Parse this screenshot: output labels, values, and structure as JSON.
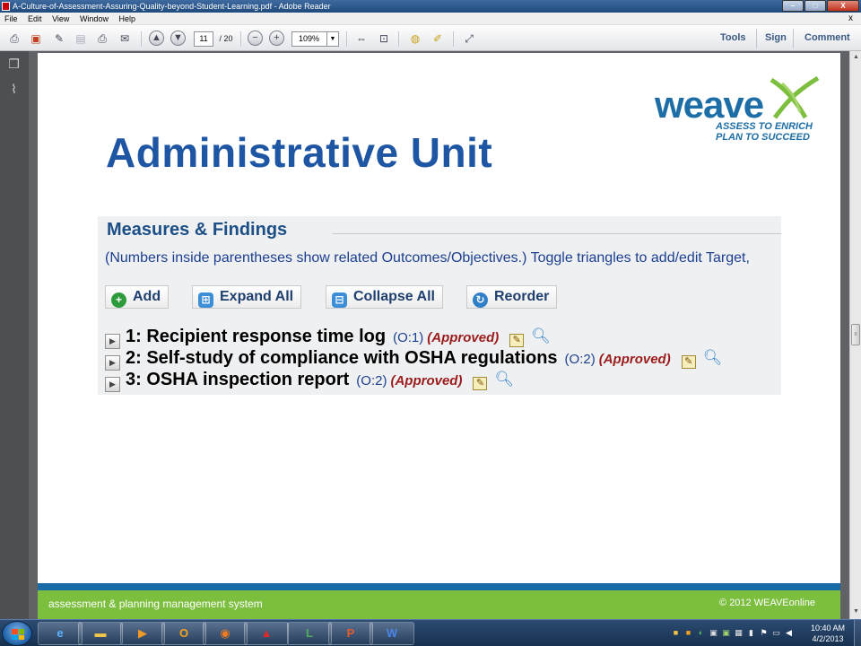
{
  "window": {
    "title": "A-Culture-of-Assessment-Assuring-Quality-beyond-Student-Learning.pdf - Adobe Reader",
    "minimize": "–",
    "maximize": "□",
    "close": "X"
  },
  "menu": {
    "items": [
      "File",
      "Edit",
      "View",
      "Window",
      "Help"
    ],
    "close_glyph": "x"
  },
  "toolbar": {
    "current_page": "11",
    "total_pages": "/ 20",
    "zoom": "109%",
    "links": [
      "Tools",
      "Sign",
      "Comment"
    ]
  },
  "slide": {
    "title": "Administrative Unit",
    "logo": {
      "word": "weave",
      "tagline_1": "ASSESS TO ENRICH",
      "tagline_2": "PLAN TO SUCCEED"
    },
    "panel": {
      "heading": "Measures & Findings",
      "note": "(Numbers inside parentheses show related Outcomes/Objectives.) Toggle triangles to add/edit Target,",
      "buttons": [
        "Add",
        "Expand All",
        "Collapse All",
        "Reorder"
      ],
      "measures": [
        {
          "title": "1: Recipient response time log",
          "ref": "(O:1)",
          "status": "(Approved)"
        },
        {
          "title": "2: Self-study of compliance with OSHA regulations",
          "ref": "(O:2)",
          "status": "(Approved)"
        },
        {
          "title": "3: OSHA inspection report",
          "ref": "(O:2)",
          "status": "(Approved)"
        }
      ]
    },
    "footer": {
      "left": "assessment & planning management system",
      "right": "© 2012 WEAVEonline"
    },
    "colors": {
      "title": "#1e56a4",
      "band_blue": "#1b6aa8",
      "band_green": "#7cbf3f",
      "status": "#9a1c1c"
    }
  },
  "taskbar": {
    "clock_time": "10:40 AM",
    "clock_date": "4/2/2013",
    "apps": [
      "internet-explorer",
      "file-explorer",
      "media-player",
      "outlook",
      "firefox",
      "adobe-reader",
      "project",
      "powerpoint",
      "word"
    ]
  }
}
